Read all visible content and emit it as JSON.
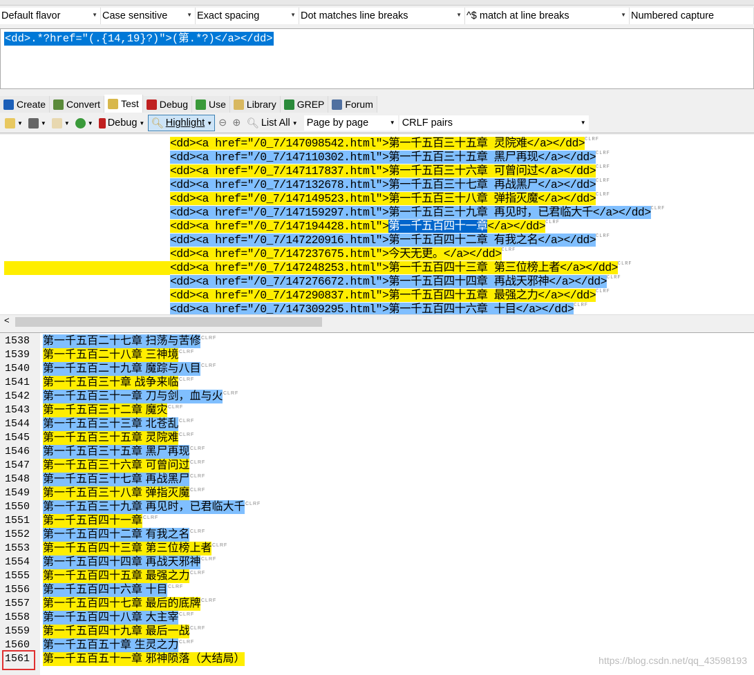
{
  "options": [
    "Default flavor",
    "Case sensitive",
    "Exact spacing",
    "Dot matches line breaks",
    "^$ match at line breaks",
    "Numbered capture"
  ],
  "regex": "<dd>.*?href=\"(.{14,19}?)\">(第.*?)</a></dd>",
  "tabs": [
    {
      "label": "Create",
      "color": "#1c5fb8"
    },
    {
      "label": "Convert",
      "color": "#5a8a3a"
    },
    {
      "label": "Test",
      "color": "#d8b84c"
    },
    {
      "label": "Debug",
      "color": "#c02020"
    },
    {
      "label": "Use",
      "color": "#3a9a3a"
    },
    {
      "label": "Library",
      "color": "#d8b860"
    },
    {
      "label": "GREP",
      "color": "#2a8a3a"
    },
    {
      "label": "Forum",
      "color": "#5070a0"
    }
  ],
  "toolbar": {
    "debug": "Debug",
    "highlight": "Highlight",
    "list_all": "List All",
    "page_mode": "Page by page",
    "line_breaks": "CRLF pairs"
  },
  "test_lines": [
    {
      "pre": "<dd><a href=\"/0_7/147098542.html\">",
      "title": "第一千五百三十五章 灵院难",
      "post": "</a></dd>",
      "hl": "y"
    },
    {
      "pre": "<dd><a href=\"/0_7/147110302.html\">",
      "title": "第一千五百三十五章 黑尸再现",
      "post": "</a></dd>",
      "hl": "b"
    },
    {
      "pre": "<dd><a href=\"/0_7/147117837.html\">",
      "title": "第一千五百三十六章 可曾问过",
      "post": "</a></dd>",
      "hl": "y"
    },
    {
      "pre": "<dd><a href=\"/0_7/147132678.html\">",
      "title": "第一千五百三十七章 再战黑尸",
      "post": "</a></dd>",
      "hl": "b"
    },
    {
      "pre": "<dd><a href=\"/0_7/147149523.html\">",
      "title": "第一千五百三十八章 弹指灭魔",
      "post": "</a></dd>",
      "hl": "y"
    },
    {
      "pre": "<dd><a href=\"/0_7/147159297.html\">",
      "title": "第一千五百三十九章 再见时，已君临大千",
      "post": "</a></dd>",
      "hl": "b"
    },
    {
      "pre": "<dd><a href=\"/0_7/147194428.html\">",
      "title": "第一千五百四十一章",
      "post": "</a></dd>",
      "hl": "sel"
    },
    {
      "pre": "<dd><a href=\"/0_7/147220916.html\">",
      "title": "第一千五百四十二章 有我之名",
      "post": "</a></dd>",
      "hl": "b"
    },
    {
      "pre": "<dd><a href=\"/0_7/147237675.html\">",
      "title": "今天无更。",
      "post": "</a></dd>",
      "hl": "y"
    },
    {
      "pre": "<dd><a href=\"/0_7/147248253.html\">",
      "title": "第一千五百四十三章 第三位榜上者",
      "post": "</a></dd>",
      "hl": "yl"
    },
    {
      "pre": "<dd><a href=\"/0_7/147276672.html\">",
      "title": "第一千五百四十四章 再战天邪神",
      "post": "</a></dd>",
      "hl": "b"
    },
    {
      "pre": "<dd><a href=\"/0_7/147290837.html\">",
      "title": "第一千五百四十五章 最强之力",
      "post": "</a></dd>",
      "hl": "y"
    },
    {
      "pre": "<dd><a href=\"/0_7/147309295.html\">",
      "title": "第一千五百四十六章 十目",
      "post": "</a></dd>",
      "hl": "b"
    }
  ],
  "results": [
    {
      "n": "1538",
      "t": "第一千五百二十七章 扫荡与苦修"
    },
    {
      "n": "1539",
      "t": "第一千五百二十八章 三神境"
    },
    {
      "n": "1540",
      "t": "第一千五百二十九章 魔踪与八目"
    },
    {
      "n": "1541",
      "t": "第一千五百三十章 战争来临"
    },
    {
      "n": "1542",
      "t": "第一千五百三十一章 刀与剑，血与火"
    },
    {
      "n": "1543",
      "t": "第一千五百三十二章 魔灾"
    },
    {
      "n": "1544",
      "t": "第一千五百三十三章 北苍乱"
    },
    {
      "n": "1545",
      "t": "第一千五百三十五章 灵院难"
    },
    {
      "n": "1546",
      "t": "第一千五百三十五章 黑尸再现"
    },
    {
      "n": "1547",
      "t": "第一千五百三十六章 可曾问过"
    },
    {
      "n": "1548",
      "t": "第一千五百三十七章 再战黑尸"
    },
    {
      "n": "1549",
      "t": "第一千五百三十八章 弹指灭魔"
    },
    {
      "n": "1550",
      "t": "第一千五百三十九章 再见时，已君临大千"
    },
    {
      "n": "1551",
      "t": "第一千五百四十一章"
    },
    {
      "n": "1552",
      "t": "第一千五百四十二章 有我之名"
    },
    {
      "n": "1553",
      "t": "第一千五百四十三章 第三位榜上者"
    },
    {
      "n": "1554",
      "t": "第一千五百四十四章 再战天邪神"
    },
    {
      "n": "1555",
      "t": "第一千五百四十五章 最强之力"
    },
    {
      "n": "1556",
      "t": "第一千五百四十六章 十目"
    },
    {
      "n": "1557",
      "t": "第一千五百四十七章 最后的底牌"
    },
    {
      "n": "1558",
      "t": "第一千五百四十八章 大主宰"
    },
    {
      "n": "1559",
      "t": "第一千五百四十九章 最后一战"
    },
    {
      "n": "1560",
      "t": "第一千五百五十章 生灵之力"
    },
    {
      "n": "1561",
      "t": "第一千五百五十一章 邪神陨落（大结局）"
    }
  ],
  "crlf": "CLRF",
  "watermark": "https://blog.csdn.net/qq_43598193",
  "colors": {
    "match_yellow": "#ffee00",
    "match_blue": "#80bfff",
    "selection": "#0066cc"
  }
}
